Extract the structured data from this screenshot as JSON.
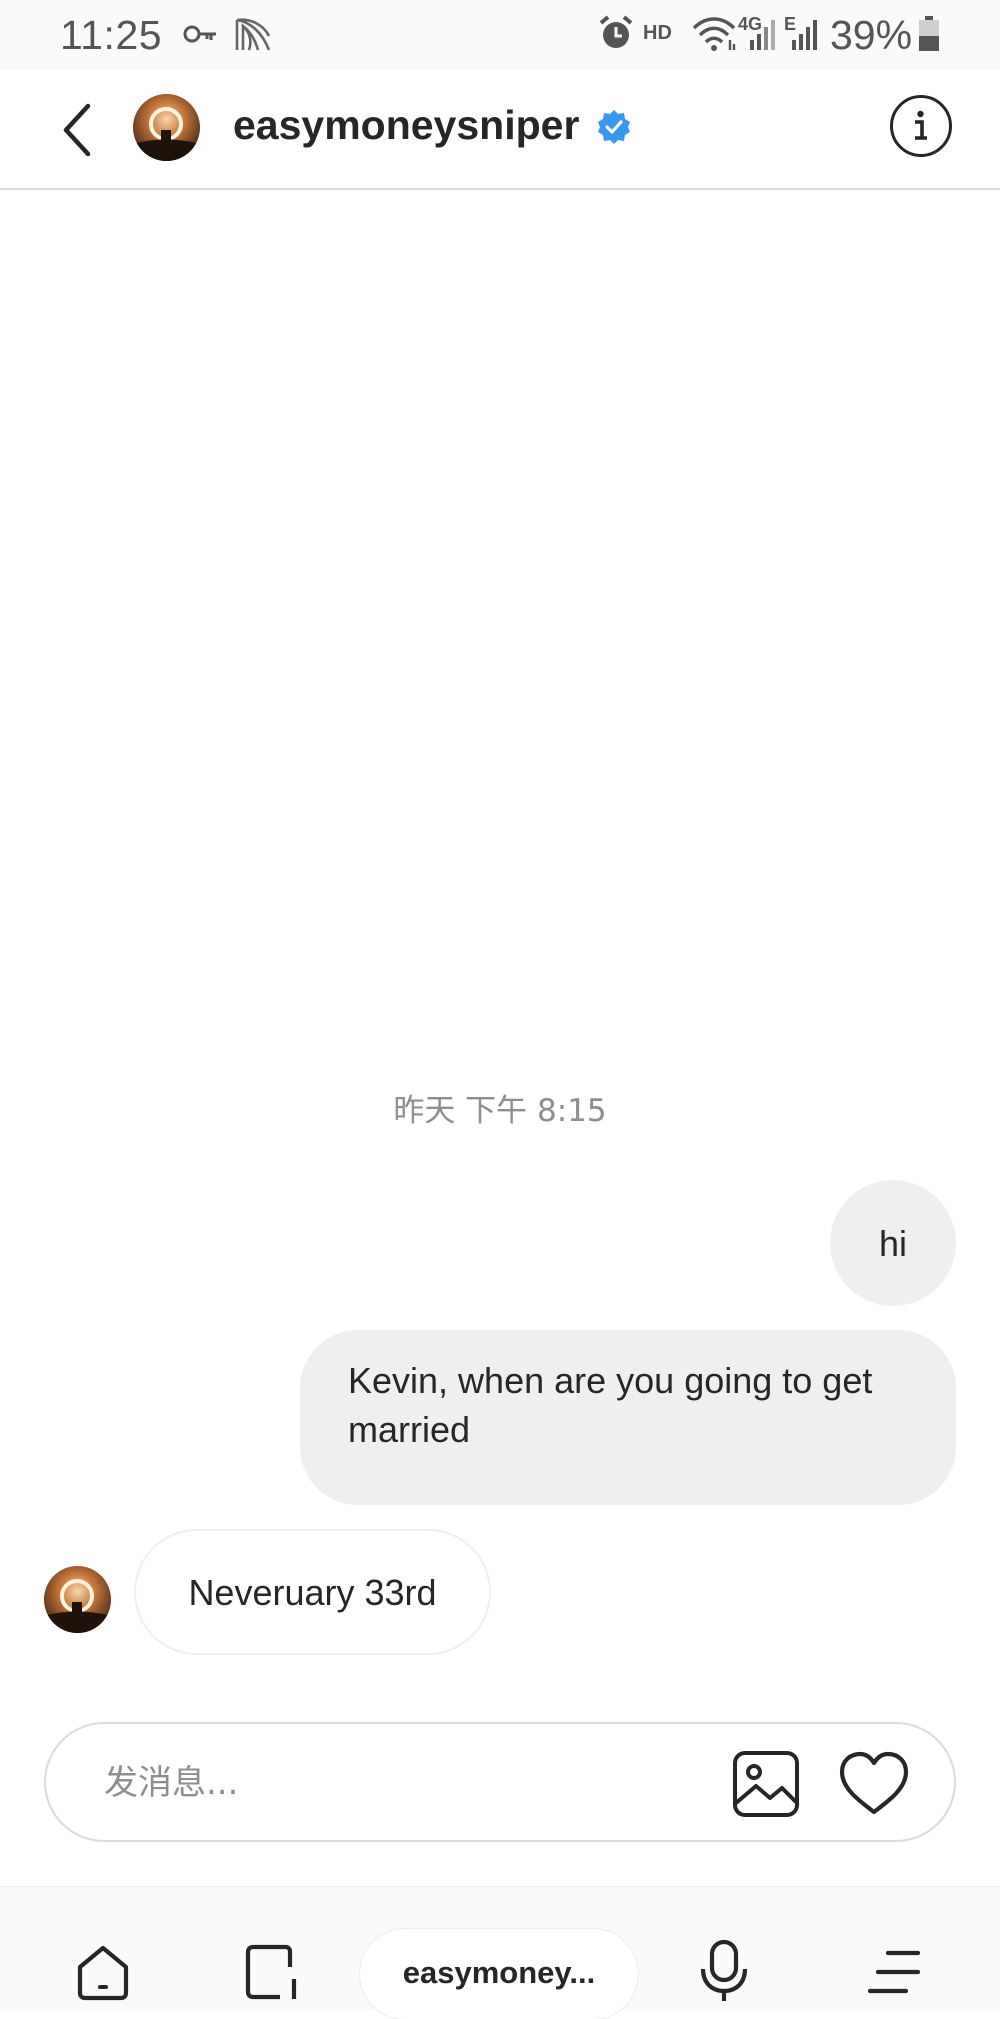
{
  "status_bar": {
    "time": "11:25",
    "hd_label": "HD",
    "network_label_1": "4G",
    "network_label_2": "E",
    "battery_percent": "39%",
    "icons": [
      "key-icon",
      "app-icon",
      "alarm-icon",
      "wifi-icon",
      "signal-icon",
      "signal-icon",
      "battery-icon"
    ]
  },
  "header": {
    "username": "easymoneysniper",
    "verified": true,
    "icons": [
      "back-arrow-icon",
      "verified-badge-icon",
      "info-icon"
    ]
  },
  "chat": {
    "timestamp": "昨天 下午 8:15",
    "messages": [
      {
        "direction": "sent",
        "text": "hi"
      },
      {
        "direction": "sent",
        "text": "Kevin, when are you going to get married"
      },
      {
        "direction": "received",
        "text": "Neveruary 33rd"
      }
    ]
  },
  "composer": {
    "placeholder": "发消息...",
    "value": "",
    "icons": [
      "gallery-icon",
      "heart-icon"
    ]
  },
  "nav_bar": {
    "app_pill_label": "easymoney...",
    "icons": [
      "home-icon",
      "recents-icon",
      "mic-icon",
      "menu-icon"
    ]
  },
  "colors": {
    "verified_blue": "#3897f0",
    "bubble_sent_bg": "#efefef",
    "text_primary": "#262626",
    "text_secondary": "#8e8e8e"
  }
}
